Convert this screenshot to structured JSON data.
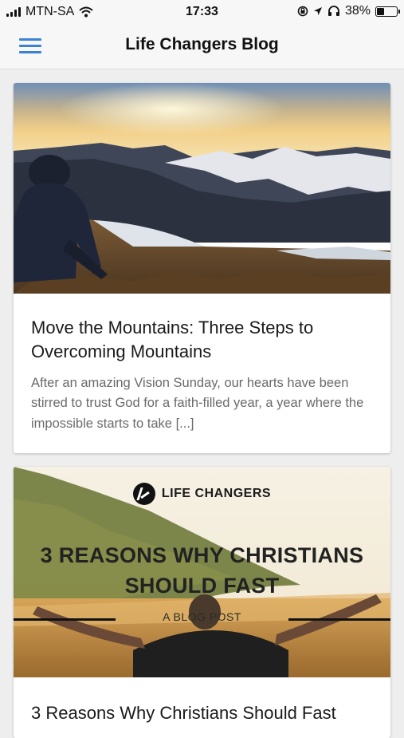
{
  "status_bar": {
    "carrier": "MTN-SA",
    "time": "17:33",
    "battery_percent": "38%",
    "battery_level": 0.38
  },
  "header": {
    "title": "Life Changers Blog"
  },
  "posts": [
    {
      "title": "Move the Mountains: Three Steps to Overcoming Mountains",
      "excerpt": "After an amazing Vision Sunday, our hearts have been stirred to trust God for a faith-filled year, a year where the impossible starts to take [...]"
    },
    {
      "title": "3 Reasons Why Christians Should Fast",
      "image_brand": "LIFE CHANGERS",
      "image_headline": "3 REASONS WHY CHRISTIANS SHOULD FAST",
      "image_subtitle": "A BLOG POST"
    }
  ],
  "colors": {
    "accent": "#3b82d6",
    "background": "#eeeeee"
  }
}
